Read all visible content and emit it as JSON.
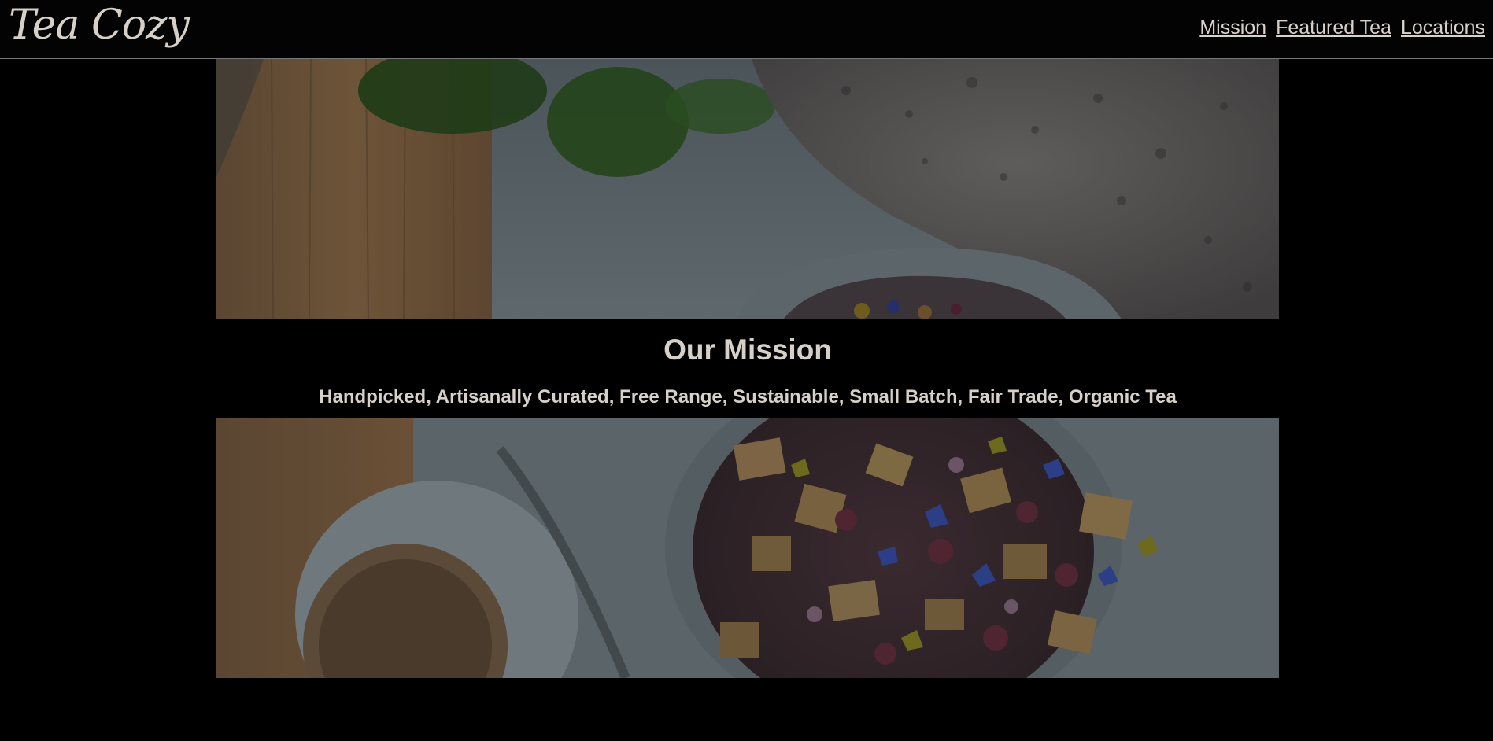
{
  "header": {
    "logo": "Tea Cozy",
    "nav": [
      "Mission",
      "Featured Tea",
      "Locations"
    ]
  },
  "mission": {
    "title": "Our Mission",
    "subtitle": "Handpicked, Artisanally Curated, Free Range, Sustainable, Small Batch, Fair Trade, Organic Tea"
  },
  "colors": {
    "background": "#000000",
    "text": "#d7d0c8",
    "header_border": "#777777"
  },
  "images": {
    "top": "tea-jar-hero-top-image",
    "bottom": "tea-jar-hero-bottom-image"
  }
}
